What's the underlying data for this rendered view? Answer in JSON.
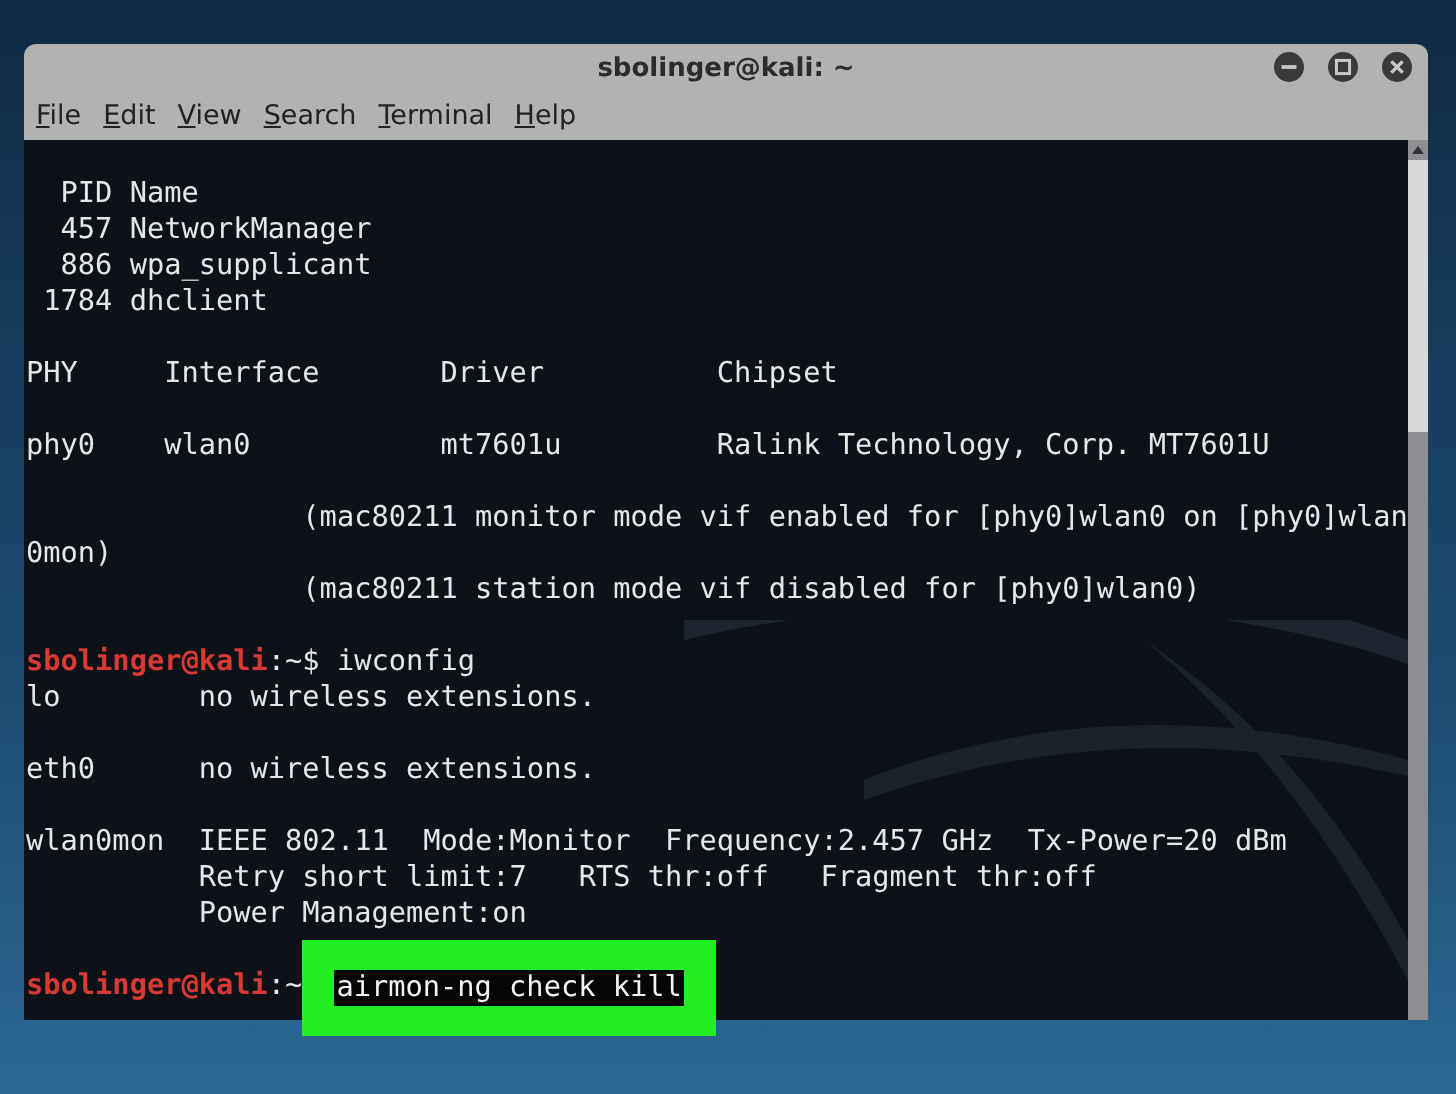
{
  "window": {
    "title": "sbolinger@kali: ~"
  },
  "menu": [
    "File",
    "Edit",
    "View",
    "Search",
    "Terminal",
    "Help"
  ],
  "terminal": {
    "lines": [
      {
        "kind": "output",
        "text": "  PID Name"
      },
      {
        "kind": "output",
        "text": "  457 NetworkManager"
      },
      {
        "kind": "output",
        "text": "  886 wpa_supplicant"
      },
      {
        "kind": "output",
        "text": " 1784 dhclient"
      },
      {
        "kind": "blank"
      },
      {
        "kind": "output",
        "text": "PHY     Interface       Driver          Chipset"
      },
      {
        "kind": "blank"
      },
      {
        "kind": "output",
        "text": "phy0    wlan0           mt7601u         Ralink Technology, Corp. MT7601U"
      },
      {
        "kind": "blank"
      },
      {
        "kind": "output",
        "text": "                (mac80211 monitor mode vif enabled for [phy0]wlan0 on [phy0]wlan"
      },
      {
        "kind": "output",
        "text": "0mon)"
      },
      {
        "kind": "output",
        "text": "                (mac80211 station mode vif disabled for [phy0]wlan0)"
      },
      {
        "kind": "blank"
      },
      {
        "kind": "prompt",
        "user": "sbolinger@kali",
        "path": ":~$ ",
        "command": "iwconfig",
        "highlighted": false
      },
      {
        "kind": "output",
        "text": "lo        no wireless extensions."
      },
      {
        "kind": "blank"
      },
      {
        "kind": "output",
        "text": "eth0      no wireless extensions."
      },
      {
        "kind": "blank"
      },
      {
        "kind": "output",
        "text": "wlan0mon  IEEE 802.11  Mode:Monitor  Frequency:2.457 GHz  Tx-Power=20 dBm"
      },
      {
        "kind": "output",
        "text": "          Retry short limit:7   RTS thr:off   Fragment thr:off"
      },
      {
        "kind": "output",
        "text": "          Power Management:on"
      },
      {
        "kind": "blank"
      },
      {
        "kind": "prompt",
        "user": "sbolinger@kali",
        "path": ":~",
        "command": "airmon-ng check kill",
        "highlighted": true
      }
    ]
  }
}
